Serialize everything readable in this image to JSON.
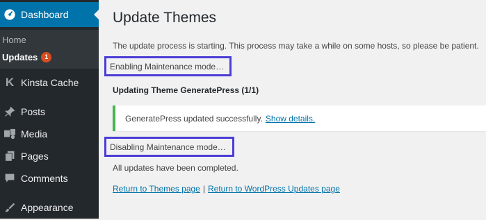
{
  "sidebar": {
    "dashboard": "Dashboard",
    "home": "Home",
    "updates": "Updates",
    "updates_count": "1",
    "kinsta_cache": "Kinsta Cache",
    "posts": "Posts",
    "media": "Media",
    "pages": "Pages",
    "comments": "Comments",
    "appearance": "Appearance"
  },
  "main": {
    "title": "Update Themes",
    "intro": "The update process is starting. This process may take a while on some hosts, so please be patient.",
    "enabling": "Enabling Maintenance mode…",
    "theme_heading": "Updating Theme GeneratePress (1/1)",
    "notice_text": "GeneratePress updated successfully.",
    "show_details": "Show details.",
    "disabling": "Disabling Maintenance mode…",
    "completed": "All updates have been completed.",
    "return_themes": "Return to Themes page",
    "separator": "|",
    "return_updates": "Return to WordPress Updates page"
  },
  "colors": {
    "sidebar_bg": "#23282d",
    "active_bg": "#0073aa",
    "highlight_border": "#4b3cd6",
    "success_border": "#46b450",
    "link": "#0073aa"
  }
}
